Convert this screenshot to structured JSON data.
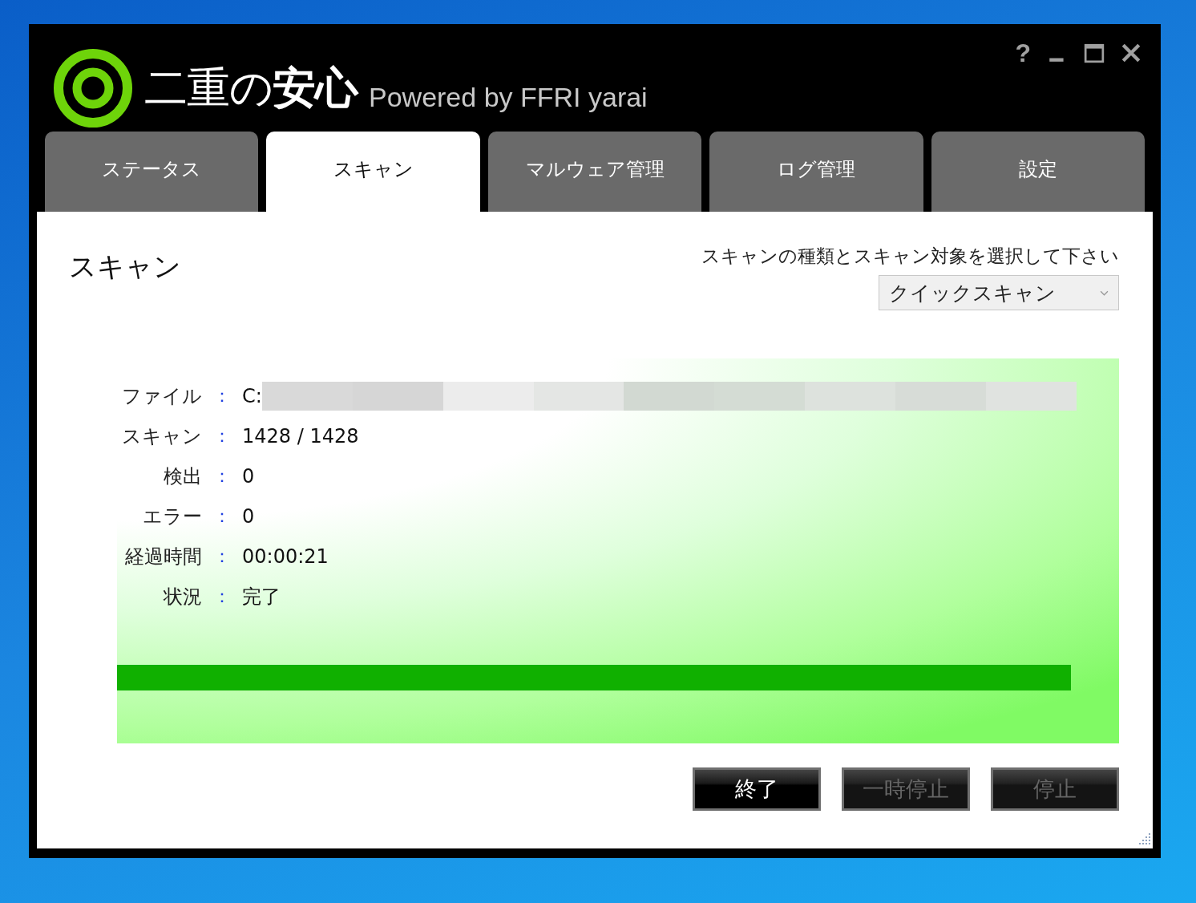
{
  "window": {
    "title": "二重の**安心**",
    "subtitle": "Powered by FFRI yarai",
    "controls": [
      {
        "kind": "help",
        "label": "?"
      },
      {
        "kind": "minimize"
      },
      {
        "kind": "maximize"
      },
      {
        "kind": "close"
      }
    ]
  },
  "tabs": [
    {
      "label": "ステータス",
      "selected": false
    },
    {
      "label": "スキャン",
      "selected": true
    },
    {
      "label": "マルウェア管理",
      "selected": false
    },
    {
      "label": "ログ管理",
      "selected": false
    },
    {
      "label": "設定",
      "selected": false
    }
  ],
  "page": {
    "heading": "スキャン",
    "prompt": "スキャンの種類とスキャン対象を選択して下さい",
    "scan_type": "クイックスキャン"
  },
  "details": [
    {
      "label": "ファイル",
      "value": "C:",
      "redacted": true
    },
    {
      "label": "スキャン",
      "value": "1428 / 1428",
      "redacted": false
    },
    {
      "label": "検出",
      "value": "0",
      "redacted": false
    },
    {
      "label": "エラー",
      "value": "0",
      "redacted": false
    },
    {
      "label": "経過時間",
      "value": "00:00:21",
      "redacted": false
    },
    {
      "label": "状況",
      "value": "完了",
      "redacted": false
    }
  ],
  "separator": "：",
  "progress": {
    "level": 1
  },
  "buttons": [
    {
      "label": "終了",
      "disabled": false
    },
    {
      "label": "一時停止",
      "disabled": true
    },
    {
      "label": "停止",
      "disabled": true
    }
  ]
}
